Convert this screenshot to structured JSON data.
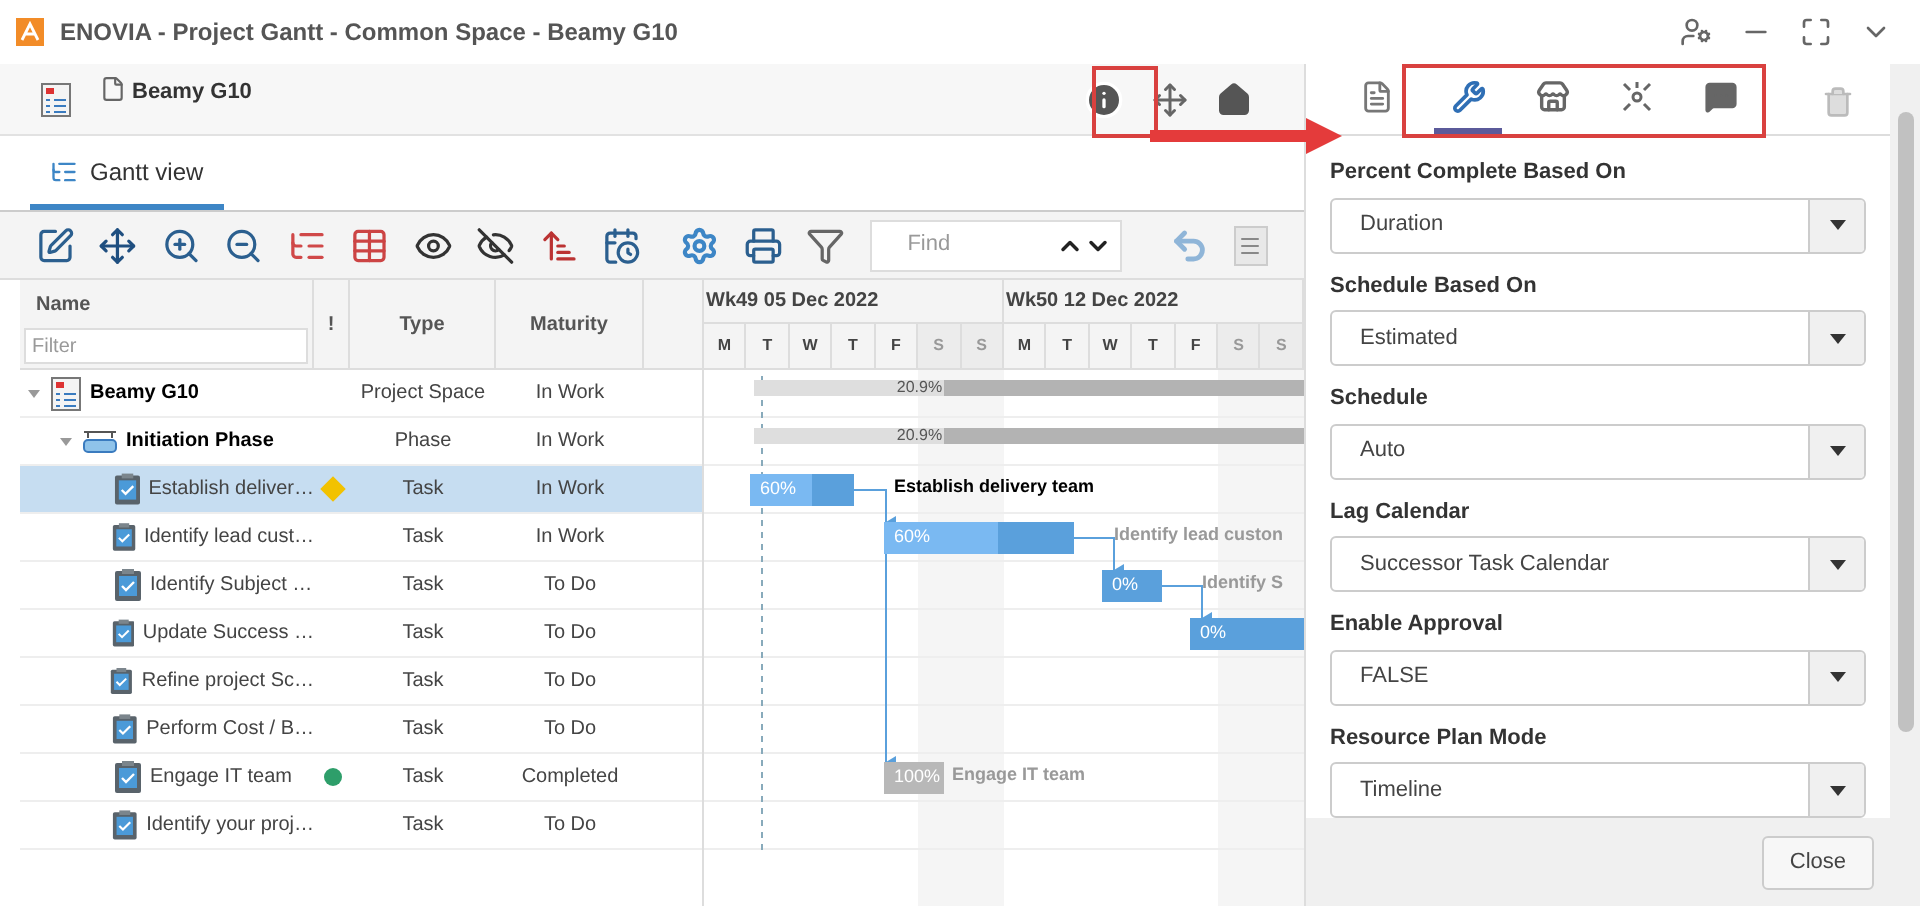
{
  "window": {
    "title": "ENOVIA - Project Gantt - Common Space - Beamy G10"
  },
  "header": {
    "title": "Beamy G10"
  },
  "tabs": [
    {
      "label": "Gantt view",
      "selected": true
    }
  ],
  "toolbar": {
    "find": {
      "placeholder": "Find"
    }
  },
  "timeline": {
    "weeks": [
      "Wk49 05 Dec 2022",
      "Wk50 12 Dec 2022"
    ],
    "days": [
      "M",
      "T",
      "W",
      "T",
      "F",
      "S",
      "S",
      "M",
      "T",
      "W",
      "T",
      "F",
      "S",
      "S"
    ]
  },
  "table": {
    "columns": [
      "Name",
      "!",
      "Type",
      "Maturity"
    ],
    "filter": {
      "placeholder": "Filter"
    },
    "rows": [
      {
        "name": "Beamy G10",
        "kind": "project",
        "expanded": true,
        "selected": false,
        "type": "Project Space",
        "maturity": "In Work",
        "bar": {
          "kind": "summary",
          "progress": "20.9%",
          "level": 0.209
        },
        "children": [
          {
            "name": "Initiation Phase",
            "kind": "phase",
            "expanded": true,
            "selected": false,
            "type": "Phase",
            "maturity": "In Work",
            "bar": {
              "kind": "summary",
              "progress": "20.9%",
              "level": 0.209
            },
            "children": [
              {
                "name": "Establish deliver…",
                "kind": "task",
                "selected": true,
                "type": "Task",
                "maturity": "In Work",
                "status": {
                  "kind": "diamond",
                  "color": "#f2c200"
                },
                "bar": {
                  "kind": "task",
                  "progress": "60%",
                  "level": 0.6,
                  "label": "Establish delivery team"
                }
              },
              {
                "name": "Identify lead cust…",
                "kind": "task",
                "selected": false,
                "type": "Task",
                "maturity": "In Work",
                "bar": {
                  "kind": "task",
                  "progress": "60%",
                  "level": 0.6,
                  "label": "Identify lead custon"
                }
              },
              {
                "name": "Identify Subject …",
                "kind": "task",
                "selected": false,
                "type": "Task",
                "maturity": "To Do",
                "bar": {
                  "kind": "task",
                  "progress": "0%",
                  "label": "Identify S"
                }
              },
              {
                "name": "Update Success …",
                "kind": "task",
                "selected": false,
                "type": "Task",
                "maturity": "To Do",
                "bar": {
                  "kind": "task",
                  "progress": "0%"
                }
              },
              {
                "name": "Refine project Sc…",
                "kind": "task",
                "selected": false,
                "type": "Task",
                "maturity": "To Do"
              },
              {
                "name": "Perform Cost / B…",
                "kind": "task",
                "selected": false,
                "type": "Task",
                "maturity": "To Do"
              },
              {
                "name": "Engage IT team",
                "kind": "task",
                "selected": false,
                "type": "Task",
                "maturity": "Completed",
                "status": {
                  "kind": "dot",
                  "color": "#2e9e6a"
                },
                "bar": {
                  "kind": "completed",
                  "progress": "100%",
                  "level": 1,
                  "label": "Engage IT team"
                }
              },
              {
                "name": "Identify your proj…",
                "kind": "task",
                "selected": false,
                "type": "Task",
                "maturity": "To Do"
              }
            ]
          }
        ]
      }
    ]
  },
  "panel": {
    "tabs": [
      {
        "kind": "document",
        "selected": false
      },
      {
        "kind": "tools",
        "selected": true
      },
      {
        "kind": "store",
        "selected": false
      },
      {
        "kind": "network",
        "selected": false
      },
      {
        "kind": "comments",
        "selected": false
      }
    ],
    "fields": [
      {
        "label": "Percent Complete Based On",
        "value": "Duration"
      },
      {
        "label": "Schedule Based On",
        "value": "Estimated"
      },
      {
        "label": "Schedule",
        "value": "Auto"
      },
      {
        "label": "Lag Calendar",
        "value": "Successor Task Calendar"
      },
      {
        "label": "Enable Approval",
        "value": "FALSE"
      },
      {
        "label": "Resource Plan Mode",
        "value": "Timeline"
      }
    ],
    "close_button": "Close"
  }
}
